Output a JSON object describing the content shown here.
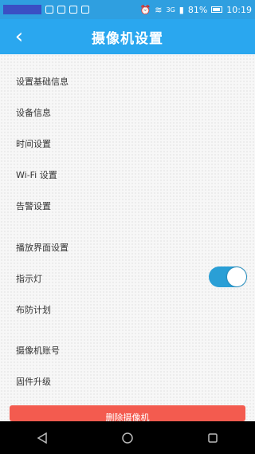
{
  "status_bar": {
    "network_type": "3G",
    "battery": "81%",
    "time": "10:19"
  },
  "header": {
    "title": "摄像机设置",
    "back_icon": "chevron-left-icon"
  },
  "menu": {
    "items": [
      "设置基础信息",
      "设备信息",
      "时间设置",
      "Wi-Fi 设置",
      "告警设置",
      "播放界面设置",
      "指示灯",
      "布防计划",
      "摄像机账号",
      "固件升级"
    ],
    "indicator_light_on": true
  },
  "bottom_button": {
    "label": "删除摄像机"
  },
  "colors": {
    "status_bar": "#2f9fe0",
    "app_bar": "#2aa7ef",
    "toggle_on": "#2a9fd6",
    "danger": "#f35b4f"
  }
}
